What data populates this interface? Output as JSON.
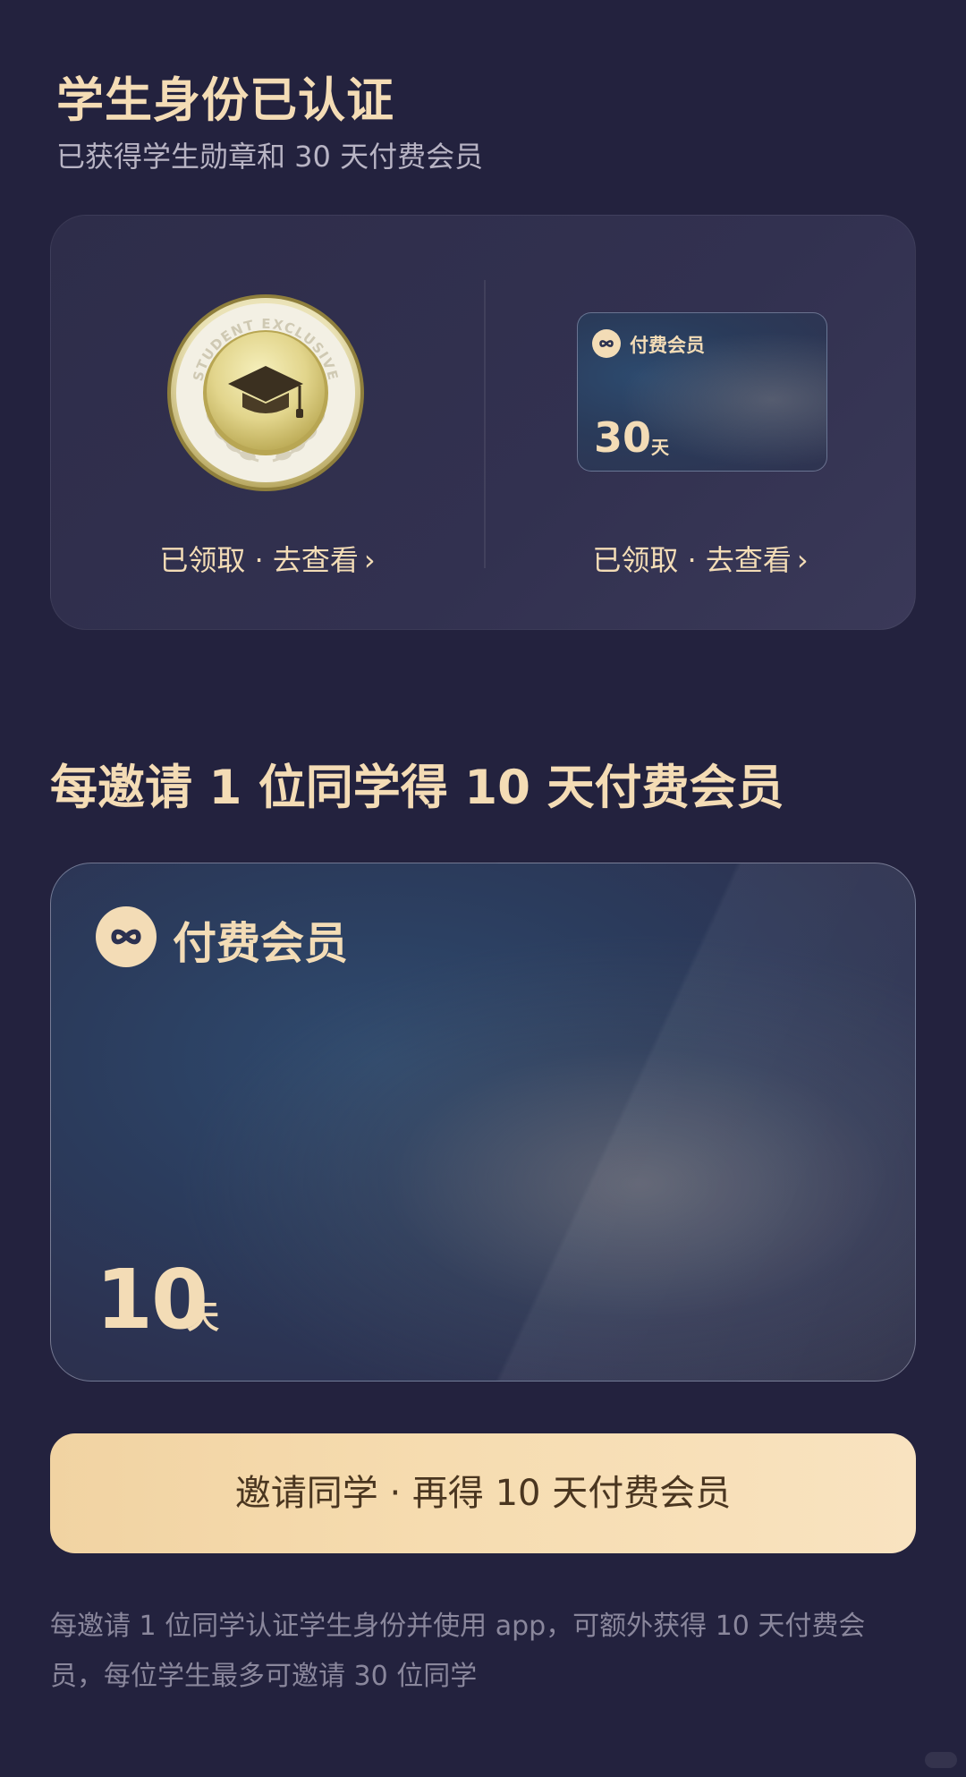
{
  "header": {
    "title": "学生身份已认证",
    "subtitle": "已获得学生勋章和 30 天付费会员"
  },
  "rewards": {
    "badge": {
      "ring_text": "STUDENT EXCLUSIVE",
      "link_label": "已领取 · 去查看",
      "chevron": "›"
    },
    "vip": {
      "label": "付费会员",
      "days": "30",
      "unit": "天",
      "link_label": "已领取 · 去查看",
      "chevron": "›"
    }
  },
  "invite": {
    "title": "每邀请 1 位同学得 10 天付费会员",
    "card": {
      "label": "付费会员",
      "days": "10",
      "unit": "天"
    },
    "button_label": "邀请同学 · 再得 10 天付费会员",
    "footnote": "每邀请 1 位同学认证学生身份并使用 app，可额外获得 10 天付费会员，每位学生最多可邀请 30 位同学"
  },
  "colors": {
    "background": "#23223e",
    "gold_text": "#f4dcb5",
    "button_gradient_start": "#f1d3a2",
    "button_gradient_end": "#f9e3c0",
    "muted_text": "#8a879c"
  },
  "icons": {
    "vip_logo": "infinity-icon",
    "badge": "graduation-cap-icon",
    "link_arrow": "chevron-right-icon"
  }
}
